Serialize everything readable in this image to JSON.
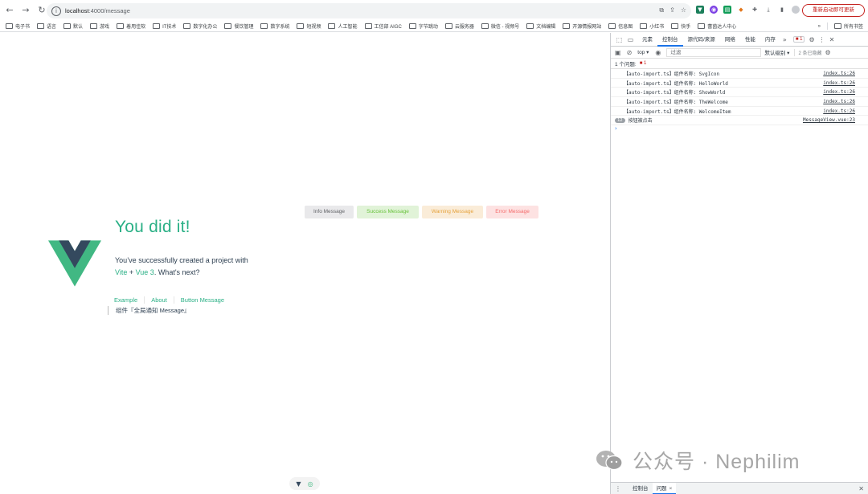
{
  "browser": {
    "nav": {
      "back": "←",
      "forward": "→",
      "reload": "↻"
    },
    "url_host": "localhost",
    "url_rest": ":4000/message",
    "update_button": "重新启动即可更新",
    "omnibox_icons": [
      "translate-icon",
      "share-icon",
      "star-icon"
    ]
  },
  "bookmarks": {
    "items": [
      "电子书",
      "语言",
      "默认",
      "游戏",
      "着用佳软",
      "IT技术",
      "数字化办公",
      "餐饮管理",
      "数字系统",
      "短视频",
      "人工智能",
      "工信部 AIGC",
      "字节跳动",
      "云服务器",
      "微信 - 视频号",
      "文档编辑",
      "开源情报网站",
      "信息图",
      "小红书",
      "快手",
      "蕾茵达人中心"
    ],
    "more": "»",
    "all": "所有书签"
  },
  "page": {
    "hello_title": "You did it!",
    "sub_line1": "You’ve successfully created a project with",
    "vite": "Vite",
    "plus": " + ",
    "vue": "Vue 3",
    "whats_next": ". What's next?",
    "nav": [
      "Example",
      "About",
      "Button Message"
    ],
    "notice": "组件『全局通知 Message』",
    "message_buttons": {
      "info": "Info Message",
      "success": "Success Message",
      "warning": "Warning Message",
      "error": "Error Message"
    },
    "watermark": "公众号 · Nephilim"
  },
  "devtools": {
    "tabs": [
      "元素",
      "控制台",
      "源代码/来源",
      "网络",
      "性能",
      "内存"
    ],
    "more": "»",
    "issue_badge": "1",
    "context": "top ▾",
    "filter_placeholder": "过滤",
    "levels": "默认级别 ▾",
    "hidden": "2 条已隐藏",
    "issues_label": "1 个问题:",
    "issues_count": "1",
    "logs": [
      {
        "msg": "【auto-import.ts】组件名称: SvgIcon",
        "src": "index.ts:26"
      },
      {
        "msg": "【auto-import.ts】组件名称: HelloWorld",
        "src": "index.ts:26"
      },
      {
        "msg": "【auto-import.ts】组件名称: ShowWorld",
        "src": "index.ts:26"
      },
      {
        "msg": "【auto-import.ts】组件名称: TheWelcome",
        "src": "index.ts:26"
      },
      {
        "msg": "【auto-import.ts】组件名称: WelcomeItem",
        "src": "index.ts:26"
      }
    ],
    "grouped": {
      "count": "12",
      "msg": "按钮被点击",
      "src": "MessageView.vue:23"
    },
    "prompt": "›",
    "drawer_tabs": [
      "控制台",
      "问题"
    ],
    "drawer_close": "×"
  },
  "colors": {
    "vue_green": "#42b883",
    "vue_dark": "#35495e",
    "link": "#2bb086"
  }
}
